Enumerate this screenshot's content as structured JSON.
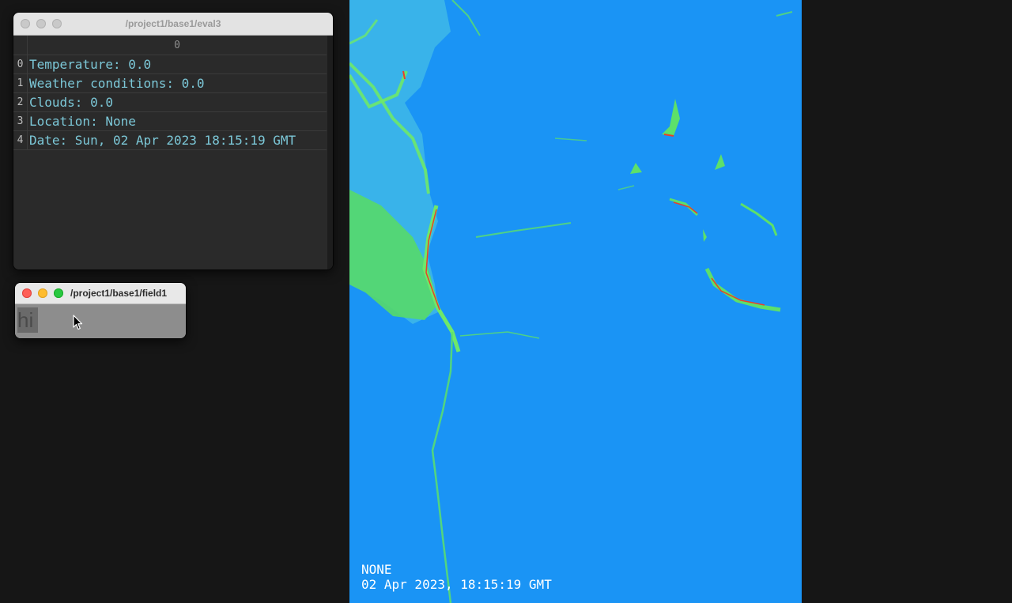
{
  "eval_window": {
    "title": "/project1/base1/eval3",
    "column_header": "0",
    "rows": [
      {
        "index": "0",
        "value": "Temperature: 0.0"
      },
      {
        "index": "1",
        "value": "Weather conditions: 0.0"
      },
      {
        "index": "2",
        "value": "Clouds: 0.0"
      },
      {
        "index": "3",
        "value": "Location: None"
      },
      {
        "index": "4",
        "value": "Date: Sun, 02 Apr 2023 18:15:19 GMT"
      }
    ]
  },
  "field_window": {
    "title": "/project1/base1/field1",
    "text_value": "hi",
    "cursor_icon": "mouse-pointer-icon"
  },
  "map_panel": {
    "location_text": "NONE",
    "date_text": "02 Apr 2023, 18:15:19 GMT"
  },
  "colors": {
    "map_background": "#1a94f5",
    "land_green": "#5fe36a",
    "coast_red": "#e8402a",
    "cell_text": "#7cc8d8"
  }
}
